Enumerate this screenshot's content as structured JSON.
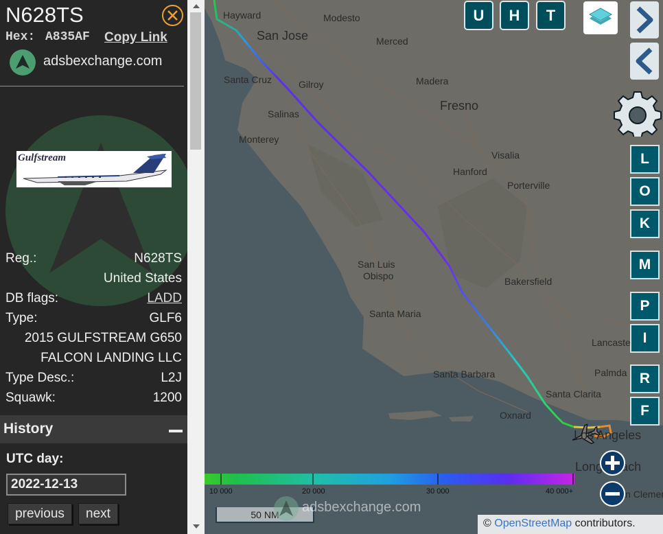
{
  "aircraft": {
    "callsign": "N628TS",
    "hex_label": "Hex:",
    "hex_value": "A835AF",
    "copy_link": "Copy Link",
    "brand": "adsbexchange.com",
    "photo_brand": "Gulfstream",
    "info": [
      {
        "label": "Reg.:",
        "value": "N628TS"
      },
      {
        "label": "",
        "value": "United States"
      },
      {
        "label": "DB flags:",
        "value": "LADD"
      },
      {
        "label": "Type:",
        "value": "GLF6"
      },
      {
        "label": "",
        "value": "2015 GULFSTREAM G650"
      },
      {
        "label": "",
        "value": "FALCON LANDING LLC"
      },
      {
        "label": "Type Desc.:",
        "value": "L2J"
      },
      {
        "label": "Squawk:",
        "value": "1200"
      }
    ]
  },
  "history": {
    "title": "History",
    "utc_label": "UTC day:",
    "date": "2022-12-13",
    "previous": "previous",
    "next": "next"
  },
  "toolbar": {
    "top_buttons": [
      "U",
      "H",
      "T"
    ],
    "side_buttons": [
      "L",
      "O",
      "K",
      "M",
      "P",
      "I",
      "R",
      "F"
    ]
  },
  "map": {
    "cities": [
      {
        "name": "Hayward",
        "big": false
      },
      {
        "name": "Modesto",
        "big": false
      },
      {
        "name": "San Jose",
        "big": true
      },
      {
        "name": "Merced",
        "big": false
      },
      {
        "name": "Santa Cruz",
        "big": false
      },
      {
        "name": "Gilroy",
        "big": false
      },
      {
        "name": "Madera",
        "big": false
      },
      {
        "name": "Fresno",
        "big": true
      },
      {
        "name": "Salinas",
        "big": false
      },
      {
        "name": "Monterey",
        "big": false
      },
      {
        "name": "Visalia",
        "big": false
      },
      {
        "name": "Hanford",
        "big": false
      },
      {
        "name": "Porterville",
        "big": false
      },
      {
        "name": "San Luis",
        "big": false
      },
      {
        "name": "Obispo",
        "big": false
      },
      {
        "name": "Bakersfield",
        "big": false
      },
      {
        "name": "Santa Maria",
        "big": false
      },
      {
        "name": "Lancaste",
        "big": false
      },
      {
        "name": "Palmda",
        "big": false
      },
      {
        "name": "Santa Barbara",
        "big": false
      },
      {
        "name": "Santa Clarita",
        "big": false
      },
      {
        "name": "Oxnard",
        "big": false
      },
      {
        "name": "Los Angeles",
        "big": true
      },
      {
        "name": "Long Beach",
        "big": true
      },
      {
        "name": "San Clemente",
        "big": false
      }
    ],
    "altitude_legend": [
      "10 000",
      "20 000",
      "30 000",
      "40 000+"
    ],
    "scale": "50 NM",
    "brand": "adsbexchange.com",
    "attribution_prefix": "©",
    "attribution_link": "OpenStreetMap",
    "attribution_suffix": "contributors."
  },
  "colors": {
    "sidebar_bg": "#262626",
    "close_accent": "#e8a23c",
    "button_teal": "#00596b",
    "zoom_navy": "#0c3a6a"
  }
}
